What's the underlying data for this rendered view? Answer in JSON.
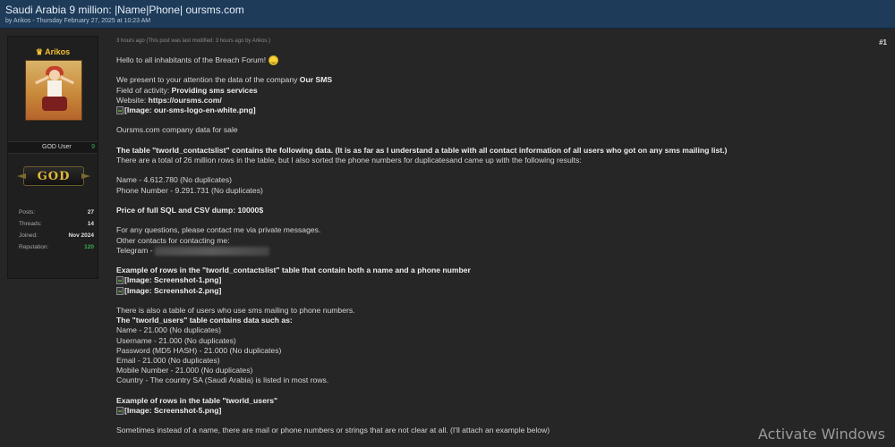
{
  "thread": {
    "title": "Saudi Arabia 9 million: |Name|Phone| oursms.com",
    "subtitle": "by Arikos - Thursday February 27, 2025 at 10:23 AM"
  },
  "user": {
    "name": "Arikos",
    "rank": "GOD User",
    "rank_count": "9",
    "badge": "GOD",
    "stats": [
      {
        "label": "Posts:",
        "value": "27"
      },
      {
        "label": "Threads:",
        "value": "14"
      },
      {
        "label": "Joined:",
        "value": "Nov 2024"
      },
      {
        "label": "Reputation:",
        "value": "120"
      }
    ]
  },
  "post": {
    "meta": "3 hours ago  (This post was last modified: 3 hours ago by Arikos.)",
    "number": "#1",
    "greeting": "Hello to all inhabitants of the Breach Forum!",
    "intro_prefix": "We present to your attention the data of the company ",
    "company": "Our SMS",
    "field_label": "Field of activity: ",
    "field_value": "Providing sms services",
    "website_label": "Website: ",
    "website": "https://oursms.com/",
    "logo_image": "[Image: our-sms-logo-en-white.png]",
    "sale_line": "Oursms.com company data for sale",
    "table_desc": "The table \"tworld_contactslist\" contains the following data. (It is as far as I understand a table with all contact information of all users who got on any sms mailing list.)",
    "rows_desc": "There are a total of 26 million rows in the table, but I also sorted the phone numbers for duplicatesand came up with the following results:",
    "name_count": "Name - 4.612.780 (No duplicates)",
    "phone_count": "Phone Number - 9.291.731 (No duplicates)",
    "price": "Price of full SQL and CSV dump: 10000$",
    "questions": "For any questions, please contact me via private messages.",
    "other_contacts": "Other contacts for contacting me:",
    "telegram": "Telegram - ",
    "example_rows": "Example of rows in the \"tworld_contactslist\" table that contain both a name and a phone number",
    "shot1": "[Image: Screenshot-1.png]",
    "shot2": "[Image: Screenshot-2.png]",
    "users_table": "There is also a table of users who use sms mailing to phone numbers.",
    "users_contains": "The \"tworld_users\" table contains data such as:",
    "u_name": "Name - 21.000 (No duplicates)",
    "u_username": "Username - 21.000 (No duplicates)",
    "u_password": "Password (MD5 HASH) - 21.000 (No duplicates)",
    "u_email": "Email - 21.000 (No duplicates)",
    "u_mobile": "Mobile Number - 21.000 (No duplicates)",
    "u_country": "Country - The country SA (Saudi Arabia) is listed in most rows.",
    "example_users": "Example of rows in the table \"tworld_users\"",
    "shot5": "[Image: Screenshot-5.png]",
    "last_line": "Sometimes instead of a name, there are mail or phone numbers or strings that are not clear at all. (I'll attach an example below)"
  },
  "watermark": "Activate Windows"
}
